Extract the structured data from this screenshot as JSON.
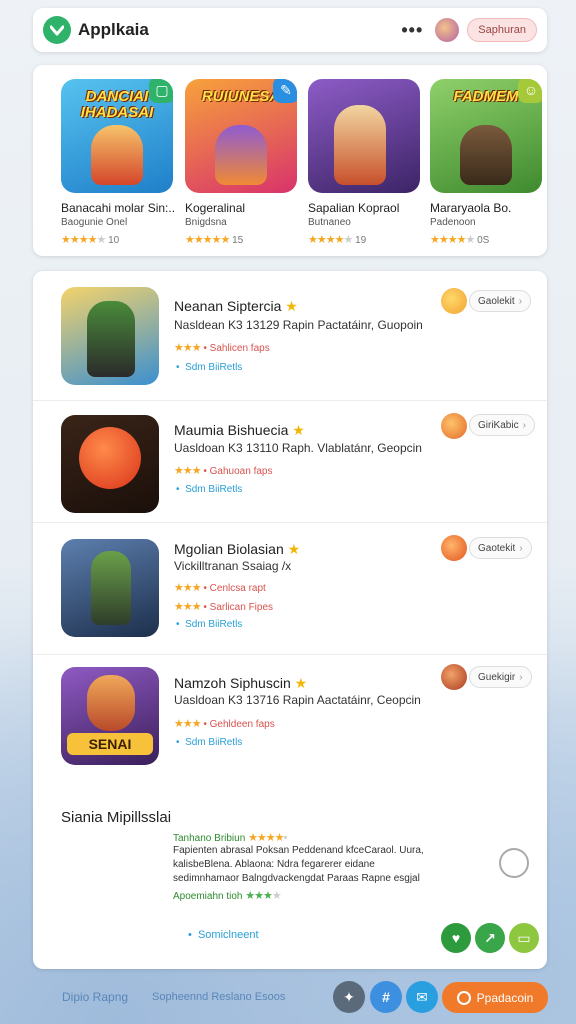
{
  "header": {
    "title": "Applkaia",
    "more_label": "•••",
    "button_label": "Saphuran"
  },
  "featured": [
    {
      "banner": "DANCIAI IHADASAI",
      "name": "Banacahi molar Sin:..",
      "sub": "Baogunie Onel",
      "rating_count": "10",
      "stars": 4.5,
      "colors": {
        "bg": "#2aa6e0",
        "badge": "#2fb36a"
      },
      "badge_icon": "square-icon"
    },
    {
      "banner": "RUIUNESA",
      "name": "Kogeralinal",
      "sub": "Bnigdsna",
      "rating_count": "15",
      "stars": 5,
      "colors": {
        "bg": "#f0622f",
        "badge": "#2a8fe0"
      },
      "badge_icon": "pencil-icon"
    },
    {
      "banner": "",
      "name": "Sapalian Kopraol",
      "sub": "Butnaneo",
      "rating_count": "19",
      "stars": 4.5,
      "colors": {
        "bg": "#6c3d9a",
        "badge": ""
      },
      "badge_icon": ""
    },
    {
      "banner": "FADMEM",
      "name": "Mararyaola   Bo.",
      "sub": "Padenoon",
      "rating_count": "0S",
      "stars": 4,
      "colors": {
        "bg": "#5fa83d",
        "badge": "#a6c93a"
      },
      "badge_icon": "smile-icon"
    }
  ],
  "apps": [
    {
      "name": "Neanan Siptercia",
      "desc": "Nasldean K3 13129  Rapin Pactatáinr, Guopoin",
      "rating_text": "Sahlicen faps",
      "stars": 3,
      "link": "Sdm BiiRetls",
      "button": "Gaolekit",
      "colors": {
        "icon": "#3a8fd0",
        "avatar": "#f2b133"
      }
    },
    {
      "name": "Maumia Bishuecia",
      "desc": "Uasldoan K3 13110  Raph. Vlablatánr, Geopcin",
      "rating_text": "Gahuoan faps",
      "stars": 3,
      "link": "Sdm BiiRetls",
      "button": "GiriKabic",
      "colors": {
        "icon": "#d9481f",
        "avatar": "#f08a34"
      }
    },
    {
      "name": "Mgolian Biolasian",
      "desc": "Vickilltranan Ssaiag /x",
      "rating_text": "Cenlcsa rapt",
      "extra_text": "Sarlican Fipes",
      "stars": 3,
      "link": "Sdm BiiRetls",
      "button": "Gaotekit",
      "colors": {
        "icon": "#2f4e78",
        "avatar": "#ee6b2c"
      }
    },
    {
      "name": "Namzoh Siphuscin",
      "desc": "Uasldoan K3 13716  Rapin Aactatáinr, Ceopcin",
      "rating_text": "Gehldeen faps",
      "stars": 3,
      "link": "Sdm BiiRetls",
      "button": "Guekigir",
      "colors": {
        "icon": "#6a3a8e",
        "avatar": "#c94f2c"
      }
    }
  ],
  "review": {
    "title": "Siania Mipillsslai",
    "head": "Tanhano Bribiun",
    "body": "Fapienten abrasal Poksan Peddenand kfceCaraol. Uura, kalisbeBlena. Ablaona: Ndra fegarerer eidane sedimnhamaor Balngdvackengdat Paraas Rapne esgjal",
    "foot": "Apoemiahn tioh",
    "link": "Somiclneent"
  },
  "footer": {
    "brand": "Dipio Rapng",
    "text": "Sopheennd Reslano Esoos",
    "cta": "Ppadacoin"
  }
}
